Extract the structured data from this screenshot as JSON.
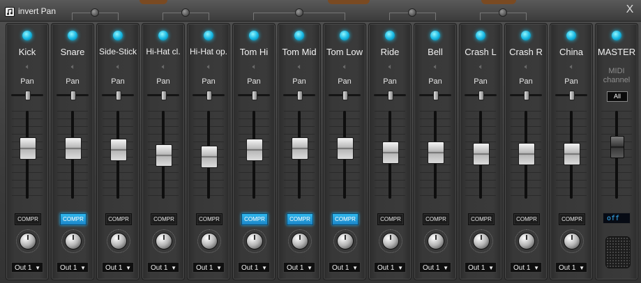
{
  "window": {
    "option_label": "invert Pan",
    "close_label": "X"
  },
  "channels": [
    {
      "name": "Kick",
      "pan_label": "Pan",
      "compr_label": "COMPR",
      "compr_on": false,
      "output": "Out 1",
      "pan": 0.0,
      "fader_level": 0.6
    },
    {
      "name": "Snare",
      "pan_label": "Pan",
      "compr_label": "COMPR",
      "compr_on": true,
      "output": "Out 1",
      "pan": 0.0,
      "fader_level": 0.6
    },
    {
      "name": "Side-Stick",
      "pan_label": "Pan",
      "compr_label": "COMPR",
      "compr_on": false,
      "output": "Out 1",
      "pan": 0.0,
      "fader_level": 0.58
    },
    {
      "name": "Hi-Hat cl.",
      "pan_label": "Pan",
      "compr_label": "COMPR",
      "compr_on": false,
      "output": "Out 1",
      "pan": 0.0,
      "fader_level": 0.5
    },
    {
      "name": "Hi-Hat op.",
      "pan_label": "Pan",
      "compr_label": "COMPR",
      "compr_on": false,
      "output": "Out 1",
      "pan": 0.0,
      "fader_level": 0.48
    },
    {
      "name": "Tom Hi",
      "pan_label": "Pan",
      "compr_label": "COMPR",
      "compr_on": true,
      "output": "Out 1",
      "pan": 0.0,
      "fader_level": 0.58
    },
    {
      "name": "Tom Mid",
      "pan_label": "Pan",
      "compr_label": "COMPR",
      "compr_on": true,
      "output": "Out 1",
      "pan": 0.0,
      "fader_level": 0.6
    },
    {
      "name": "Tom Low",
      "pan_label": "Pan",
      "compr_label": "COMPR",
      "compr_on": true,
      "output": "Out 1",
      "pan": 0.0,
      "fader_level": 0.6
    },
    {
      "name": "Ride",
      "pan_label": "Pan",
      "compr_label": "COMPR",
      "compr_on": false,
      "output": "Out 1",
      "pan": 0.0,
      "fader_level": 0.54
    },
    {
      "name": "Bell",
      "pan_label": "Pan",
      "compr_label": "COMPR",
      "compr_on": false,
      "output": "Out 1",
      "pan": 0.0,
      "fader_level": 0.54
    },
    {
      "name": "Crash L",
      "pan_label": "Pan",
      "compr_label": "COMPR",
      "compr_on": false,
      "output": "Out 1",
      "pan": 0.0,
      "fader_level": 0.52
    },
    {
      "name": "Crash R",
      "pan_label": "Pan",
      "compr_label": "COMPR",
      "compr_on": false,
      "output": "Out 1",
      "pan": 0.0,
      "fader_level": 0.52
    },
    {
      "name": "China",
      "pan_label": "Pan",
      "compr_label": "COMPR",
      "compr_on": false,
      "output": "Out 1",
      "pan": 0.0,
      "fader_level": 0.52
    }
  ],
  "master": {
    "name": "MASTER",
    "midi_label_1": "MIDI",
    "midi_label_2": "channel",
    "midi_value": "All",
    "status": "off",
    "fader_level": 0.62
  },
  "colors": {
    "led": "#1ec8f0",
    "compr_on": "#2bb3ee"
  }
}
